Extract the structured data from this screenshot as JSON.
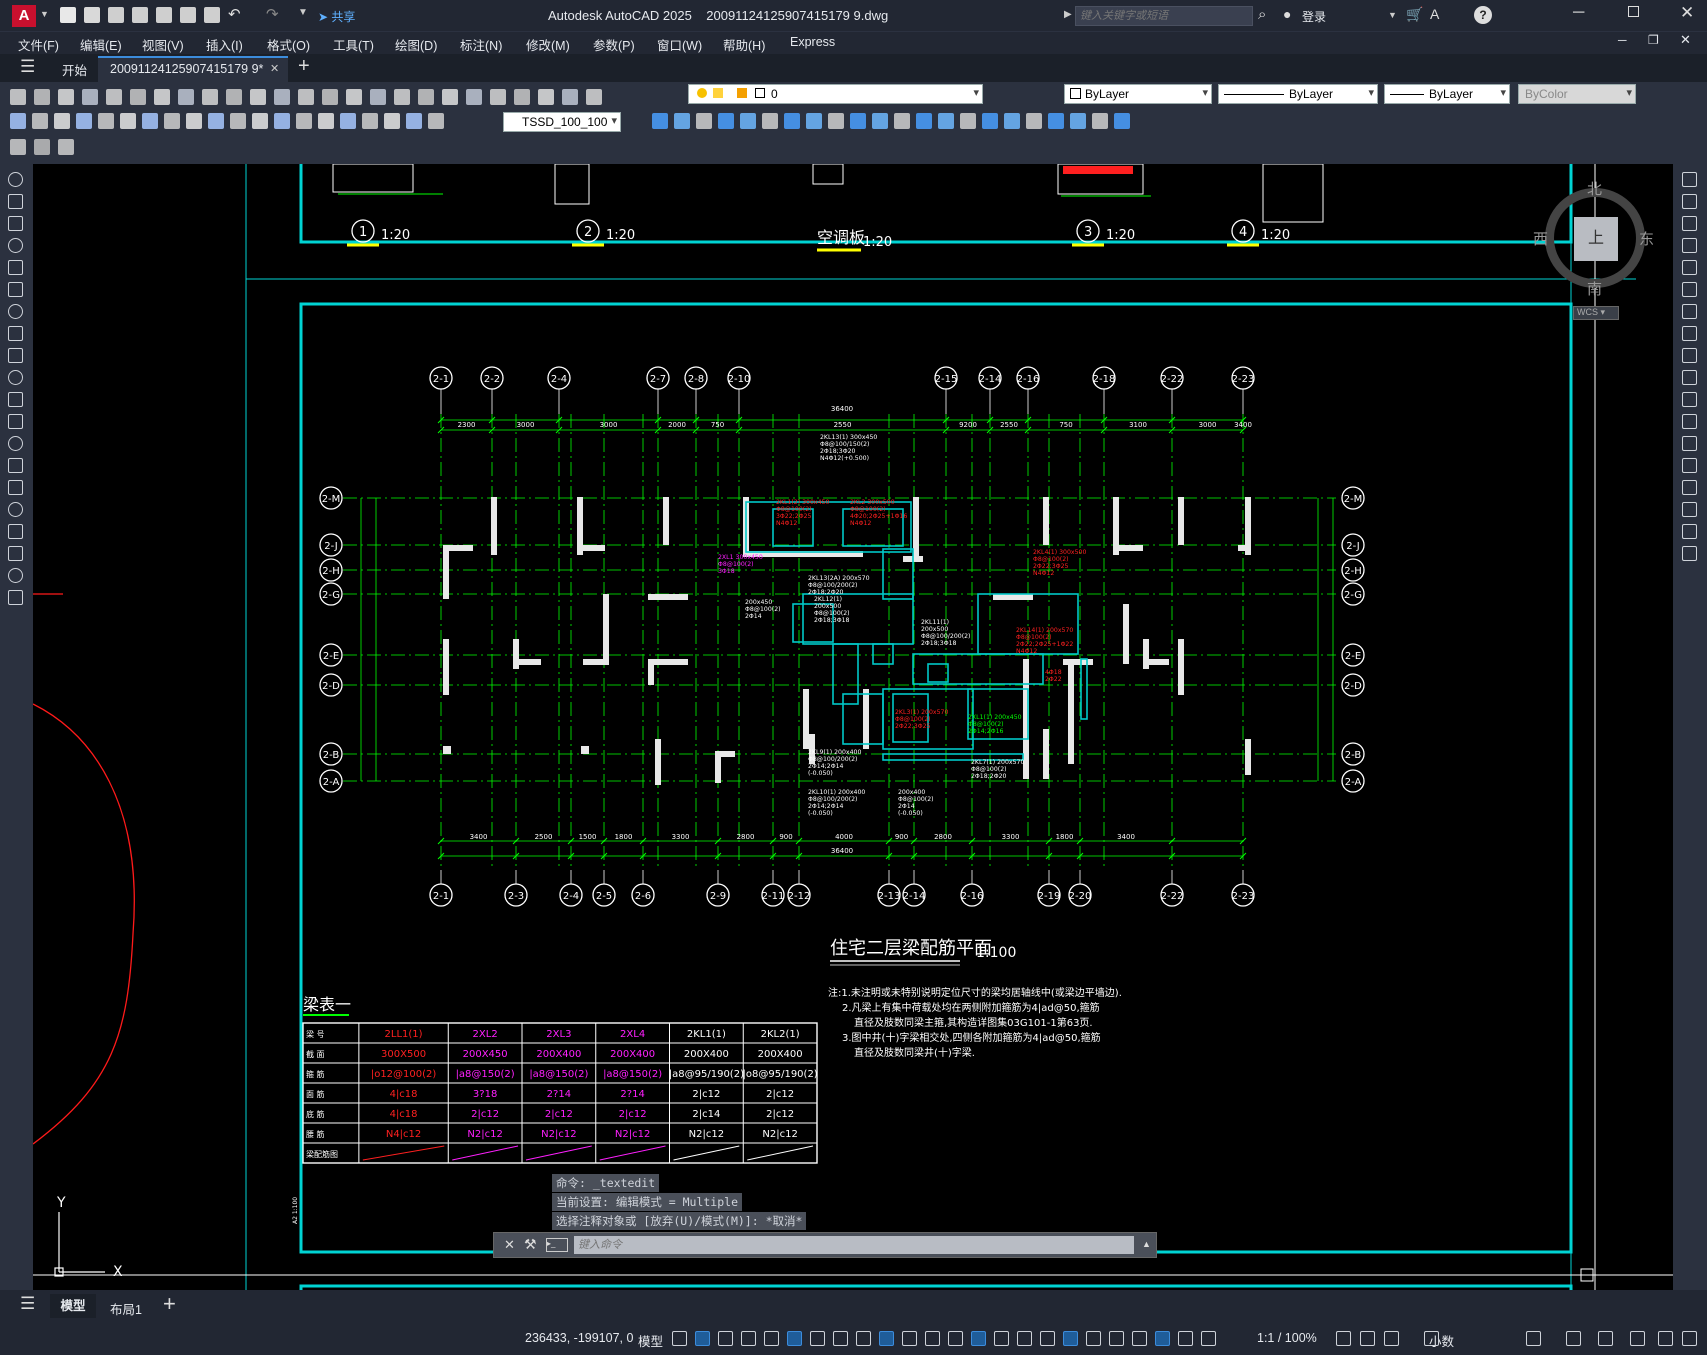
{
  "window": {
    "title": "Autodesk AutoCAD 2025    20091124125907415179 9.dwg",
    "search_placeholder": "键入关键字或短语",
    "login": "登录",
    "share": "共享",
    "app_letter": "A"
  },
  "menu": [
    "文件(F)",
    "编辑(E)",
    "视图(V)",
    "插入(I)",
    "格式(O)",
    "工具(T)",
    "绘图(D)",
    "标注(N)",
    "修改(M)",
    "参数(P)",
    "窗口(W)",
    "帮助(H)",
    "Express"
  ],
  "tabs": {
    "start": "开始",
    "active": "20091124125907415179 9*"
  },
  "layer": {
    "current": "0"
  },
  "props": {
    "color": "ByLayer",
    "linetype": "ByLayer",
    "lineweight": "ByLayer",
    "plotstyle": "ByColor"
  },
  "dimstyle": "TSSD_100_100",
  "viewcube": {
    "north": "北",
    "south": "南",
    "east": "东",
    "west": "西",
    "top": "上",
    "wcs": "WCS"
  },
  "drawing": {
    "details": [
      {
        "num": "1",
        "scale": "1:20"
      },
      {
        "num": "2",
        "scale": "1:20"
      },
      {
        "label": "空调板",
        "scale": "1:20"
      },
      {
        "num": "3",
        "scale": "1:20"
      },
      {
        "num": "4",
        "scale": "1:20"
      }
    ],
    "top_axes": [
      "2-1",
      "2-2",
      "2-4",
      "2-7",
      "2-8",
      "2-10",
      "2-15",
      "2-14",
      "2-16",
      "2-18",
      "2-22",
      "2-23"
    ],
    "bottom_axes": [
      "2-1",
      "2-3",
      "2-4",
      "2-5",
      "2-6",
      "2-9",
      "2-11",
      "2-12",
      "2-13",
      "2-14",
      "2-16",
      "2-19",
      "2-20",
      "2-22",
      "2-23"
    ],
    "left_axes": [
      "2-M",
      "2-J",
      "2-H",
      "2-G",
      "2-E",
      "2-D",
      "2-B",
      "2-A"
    ],
    "right_axes": [
      "2-M",
      "2-J",
      "2-H",
      "2-G",
      "2-E",
      "2-D",
      "2-B",
      "2-A"
    ],
    "top_dims": [
      "2300",
      "3000",
      "3000",
      "2000",
      "750",
      "2550",
      "9200",
      "2550",
      "750",
      "3100",
      "3000",
      "3400"
    ],
    "bottom_dims": [
      "3400",
      "2500",
      "1500",
      "1800",
      "3300",
      "2800",
      "900",
      "4000",
      "900",
      "2800",
      "3300",
      "1800",
      "3400"
    ],
    "total_dim": "36400",
    "plan_title": "住宅二层梁配筋平面",
    "plan_scale": "1:100",
    "notes": [
      "注:1.未注明或未特别说明定位尺寸的梁均居轴线中(或梁边平墙边).",
      "2.凡梁上有集中荷载处均在两侧附加箍筋为4|ad@50,箍筋",
      "直径及肢数同梁主箍,其构造详图集03G101-1第63页.",
      "3.图中井(十)字梁相交处,四侧各附加箍筋为4|ad@50,箍筋",
      "直径及肢数同梁井(十)字梁."
    ],
    "table_title": "梁表一",
    "table": {
      "row_labels": [
        "梁 号",
        "截 面",
        "箍 筋",
        "面 筋",
        "底 筋",
        "腰 筋",
        "梁配筋图"
      ],
      "columns": [
        {
          "color": "#ff2020",
          "cells": [
            "2LL1(1)",
            "300X500",
            "|o12@100(2)",
            "4|c18",
            "4|c18",
            "N4|c12"
          ]
        },
        {
          "color": "#ff20ff",
          "cells": [
            "2XL2",
            "200X450",
            "|a8@150(2)",
            "3?18",
            "2|c12",
            "N2|c12"
          ]
        },
        {
          "color": "#ff20ff",
          "cells": [
            "2XL3",
            "200X400",
            "|a8@150(2)",
            "2?14",
            "2|c12",
            "N2|c12"
          ]
        },
        {
          "color": "#ff20ff",
          "cells": [
            "2XL4",
            "200X400",
            "|a8@150(2)",
            "2?14",
            "2|c12",
            "N2|c12"
          ]
        },
        {
          "color": "#ffffff",
          "cells": [
            "2KL1(1)",
            "200X400",
            "|a8@95/190(2)",
            "2|c12",
            "2|c14",
            "N2|c12"
          ]
        },
        {
          "color": "#ffffff",
          "cells": [
            "2KL2(1)",
            "200X400",
            "|o8@95/190(2)",
            "2|c12",
            "2|c12",
            "N2|c12"
          ]
        }
      ]
    },
    "side_scale": "A2 1:100"
  },
  "command": {
    "history": [
      "命令: _textedit",
      "当前设置: 编辑模式 = Multiple",
      "选择注释对象或 [放弃(U)/模式(M)]: *取消*"
    ],
    "placeholder": "键入命令"
  },
  "layouts": [
    "模型",
    "布局1"
  ],
  "status": {
    "coords": "236433, -199107, 0",
    "model": "模型",
    "scale": "1:1 / 100%",
    "units": "小数"
  }
}
